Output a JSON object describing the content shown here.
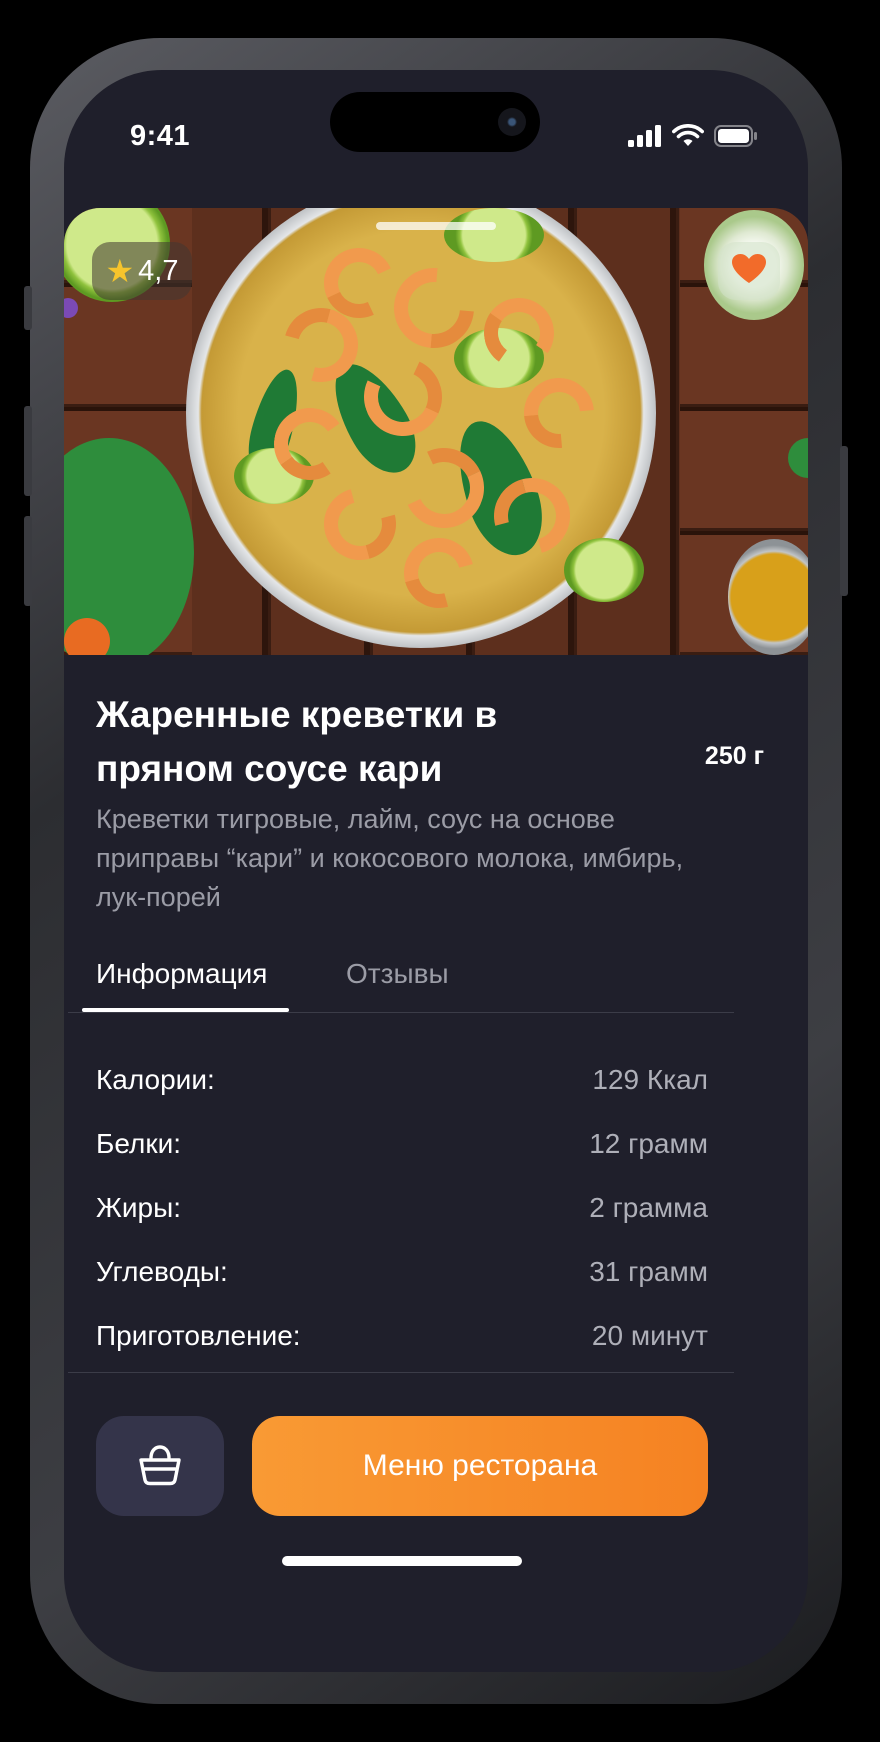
{
  "status_bar": {
    "time": "9:41",
    "signal_icon": "cellular-signal-icon",
    "wifi_icon": "wifi-icon",
    "battery_icon": "battery-icon"
  },
  "hero": {
    "image_desc": "shrimp-curry-pan",
    "rating": "4,7",
    "rating_icon": "star-icon",
    "favorite_icon": "heart-icon"
  },
  "dish": {
    "title": "Жаренные креветки в пряном соусе кари",
    "weight": "250 г",
    "description": "Креветки тигровые, лайм, соус на основе приправы “кари” и кокосового молока, имбирь, лук-порей"
  },
  "tabs": [
    {
      "label": "Информация",
      "active": true
    },
    {
      "label": "Отзывы",
      "active": false
    }
  ],
  "nutrition": [
    {
      "label": "Калории:",
      "value": "129 Ккал"
    },
    {
      "label": "Белки:",
      "value": "12 грамм"
    },
    {
      "label": "Жиры:",
      "value": "2 грамма"
    },
    {
      "label": "Углеводы:",
      "value": "31 грамм"
    },
    {
      "label": "Приготовление:",
      "value": "20 минут"
    }
  ],
  "actions": {
    "cart_icon": "shopping-basket-icon",
    "menu_label": "Меню ресторана"
  },
  "colors": {
    "background": "#1f1f2b",
    "accent": "#f58222",
    "heart": "#f26b2a",
    "star": "#f6c42c",
    "muted_text": "#9b9ca6"
  }
}
